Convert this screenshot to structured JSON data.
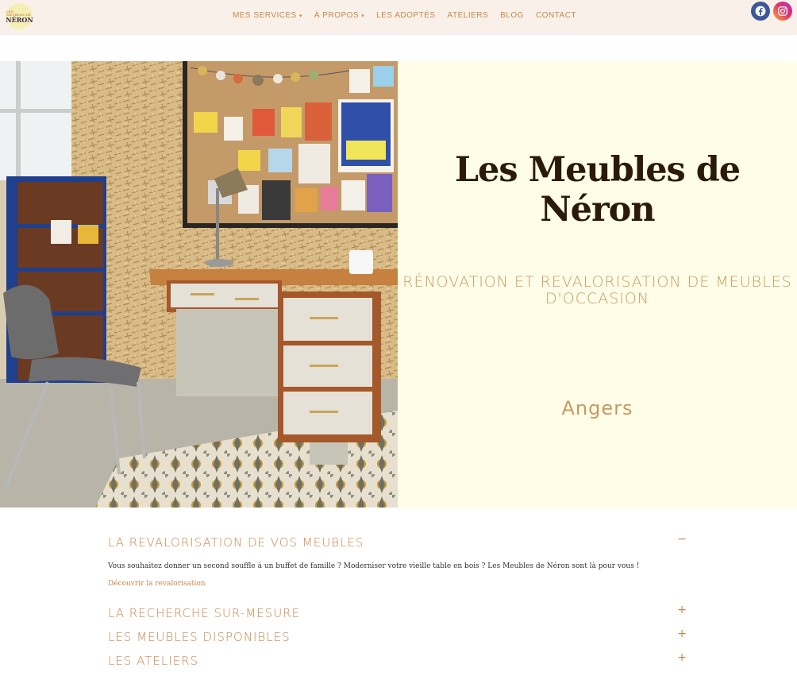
{
  "header": {
    "logo_line1": "LES MEUBLES DE",
    "logo_line2": "NÉRON",
    "nav": [
      {
        "label": "MES SERVICES",
        "has_dropdown": true
      },
      {
        "label": "À PROPOS",
        "has_dropdown": true
      },
      {
        "label": "LES ADOPTÉS",
        "has_dropdown": false
      },
      {
        "label": "ATELIERS",
        "has_dropdown": false
      },
      {
        "label": "BLOG",
        "has_dropdown": false
      },
      {
        "label": "CONTACT",
        "has_dropdown": false
      }
    ],
    "social": [
      {
        "icon": "facebook-icon",
        "color": "#3b5998"
      },
      {
        "icon": "instagram-icon",
        "color": "#e0306e"
      }
    ]
  },
  "hero": {
    "title": "Les Meubles de Néron",
    "subtitle": "RÉNOVATION ET REVALORISATION DE MEUBLES D'OCCASION",
    "city": "Angers",
    "panel_color": "#fffde7"
  },
  "accordion": {
    "items": [
      {
        "title": "LA REVALORISATION DE VOS MEUBLES",
        "toggle": "−",
        "expanded": true
      },
      {
        "title": "LA RECHERCHE SUR-MESURE",
        "toggle": "+",
        "expanded": false
      },
      {
        "title": "LES MEUBLES DISPONIBLES",
        "toggle": "+",
        "expanded": false
      },
      {
        "title": "LES ATELIERS",
        "toggle": "+",
        "expanded": false
      }
    ],
    "expanded_text": "Vous souhaitez donner un second souffle à un buffet de famille ? Moderniser votre vieille table en bois ? Les Meubles de Néron sont là pour vous !",
    "expanded_link": "Découvrir la revalorisation"
  },
  "colors": {
    "accent": "#c9864b",
    "header_bg": "#f9f1e9",
    "title": "#2b1a0a"
  }
}
